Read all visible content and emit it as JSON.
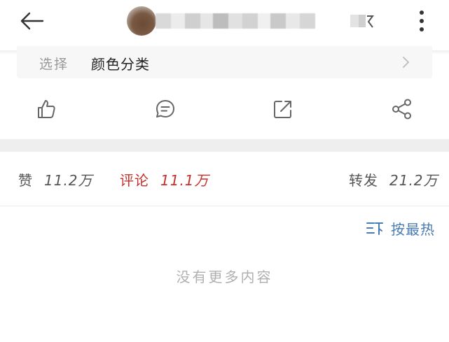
{
  "header": {
    "back_icon": "back-arrow-icon",
    "more_icon": "more-vertical-icon"
  },
  "option_selector": {
    "label": "选择",
    "value": "颜色分类"
  },
  "actions": [
    {
      "icon": "thumbs-up-icon"
    },
    {
      "icon": "comment-icon"
    },
    {
      "icon": "forward-icon"
    },
    {
      "icon": "share-icon"
    }
  ],
  "stats": {
    "like_label": "赞",
    "like_count": "11.2万",
    "comment_label": "评论",
    "comment_count": "11.1万",
    "repost_label": "转发",
    "repost_count": "21.2万"
  },
  "sort": {
    "label": "按最热",
    "icon": "sort-icon"
  },
  "empty_state": {
    "text": "没有更多内容"
  },
  "colors": {
    "accent_red": "#c4302b",
    "link_blue": "#4a7bb3",
    "muted_gray": "#b0b0b0",
    "band_gray": "#eeeeee"
  }
}
